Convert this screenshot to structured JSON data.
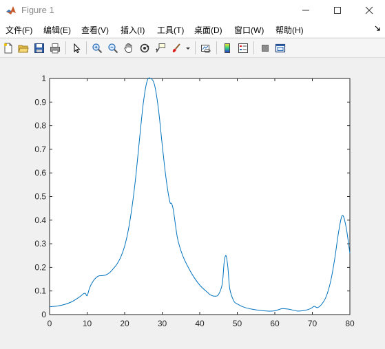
{
  "window": {
    "title": "Figure 1"
  },
  "menu": [
    "文件(F)",
    "编辑(E)",
    "查看(V)",
    "插入(I)",
    "工具(T)",
    "桌面(D)",
    "窗口(W)",
    "帮助(H)"
  ],
  "toolbar": [
    "new-figure-icon",
    "open-file-icon",
    "save-icon",
    "print-icon",
    "select-arrow-icon",
    "zoom-in-icon",
    "zoom-out-icon",
    "pan-hand-icon",
    "rotate-3d-icon",
    "data-cursor-icon",
    "brush-icon",
    "brush-dropdown-icon",
    "link-plot-icon",
    "colorbar-icon",
    "legend-icon",
    "hide-plot-tools-icon",
    "show-plot-tools-icon"
  ],
  "colors": {
    "line": "#0072bd",
    "axes_bg": "#ffffff",
    "figure_bg": "#f0f0f0"
  },
  "chart_data": {
    "type": "line",
    "xlim": [
      0,
      80
    ],
    "ylim": [
      0,
      1
    ],
    "xticks": [
      "0",
      "10",
      "20",
      "30",
      "40",
      "50",
      "60",
      "70",
      "80"
    ],
    "yticks": [
      "0",
      "0.1",
      "0.2",
      "0.3",
      "0.4",
      "0.5",
      "0.6",
      "0.7",
      "0.8",
      "0.9",
      "1"
    ],
    "grid": false,
    "series": [
      {
        "x": [
          0,
          2,
          4,
          6,
          8,
          9,
          9.5,
          10,
          10.5,
          11,
          12,
          13,
          14,
          15,
          16,
          17,
          18,
          19,
          20,
          21,
          22,
          23,
          24,
          25,
          26,
          27,
          28,
          29,
          30,
          31,
          32,
          32.5,
          33,
          34,
          35,
          36,
          38,
          40,
          42,
          43,
          44,
          45,
          46,
          46.5,
          47,
          47.5,
          48,
          49,
          50,
          52,
          55,
          58,
          60,
          62,
          64,
          66,
          68,
          69.5,
          70.5,
          71.5,
          73,
          74,
          75,
          76,
          77,
          78,
          79,
          80
        ],
        "y": [
          0.033,
          0.036,
          0.043,
          0.055,
          0.075,
          0.088,
          0.09,
          0.08,
          0.105,
          0.125,
          0.15,
          0.163,
          0.165,
          0.168,
          0.178,
          0.195,
          0.215,
          0.245,
          0.29,
          0.36,
          0.46,
          0.59,
          0.75,
          0.9,
          0.99,
          1.0,
          0.97,
          0.87,
          0.72,
          0.58,
          0.48,
          0.47,
          0.44,
          0.33,
          0.27,
          0.23,
          0.17,
          0.125,
          0.095,
          0.082,
          0.078,
          0.085,
          0.13,
          0.22,
          0.25,
          0.2,
          0.11,
          0.06,
          0.045,
          0.03,
          0.02,
          0.015,
          0.016,
          0.025,
          0.022,
          0.015,
          0.018,
          0.025,
          0.035,
          0.03,
          0.055,
          0.09,
          0.15,
          0.24,
          0.35,
          0.42,
          0.37,
          0.26
        ]
      }
    ]
  }
}
